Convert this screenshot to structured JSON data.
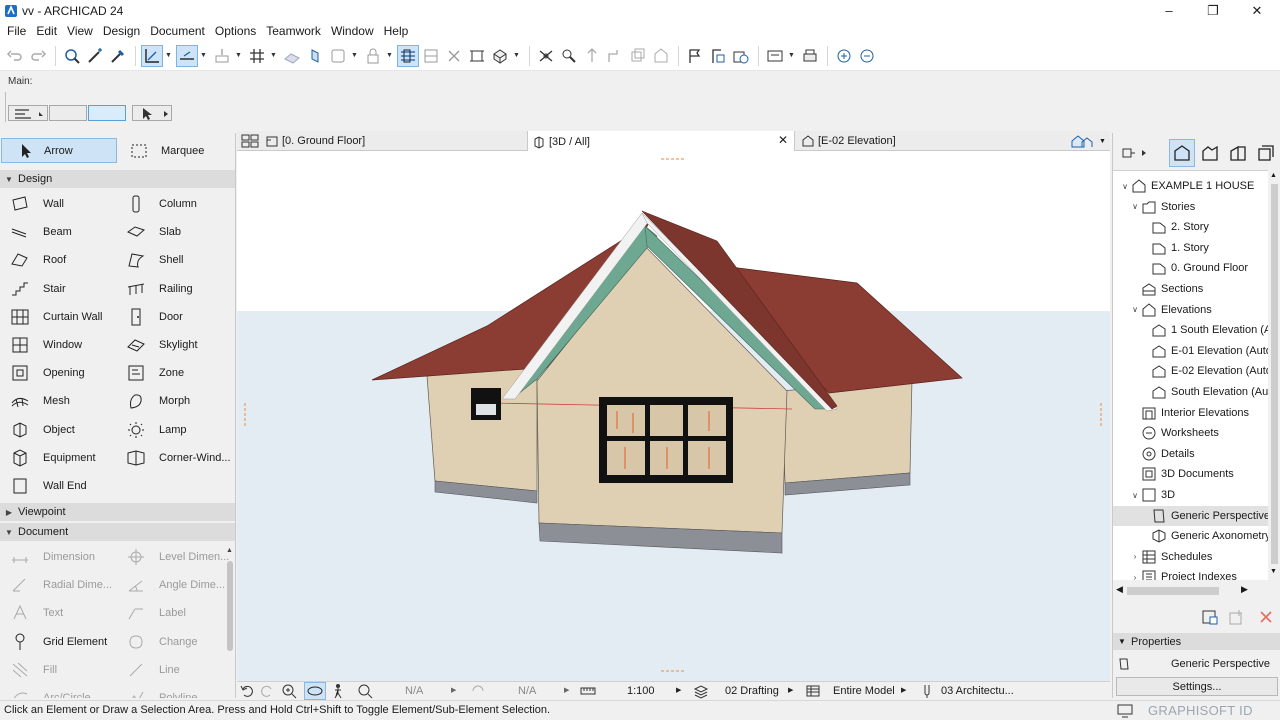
{
  "window": {
    "title": "vv - ARCHICAD 24",
    "minimize": "–",
    "maximize": "❐",
    "close": "✕"
  },
  "menu": [
    "File",
    "Edit",
    "View",
    "Design",
    "Document",
    "Options",
    "Teamwork",
    "Window",
    "Help"
  ],
  "infobox": {
    "main_label": "Main:"
  },
  "toolbox": {
    "arrow_label": "Arrow",
    "marquee_label": "Marquee",
    "design_header": "Design",
    "design_tools": [
      {
        "label": "Wall",
        "icon": "wall-icon"
      },
      {
        "label": "Column",
        "icon": "column-icon"
      },
      {
        "label": "Beam",
        "icon": "beam-icon"
      },
      {
        "label": "Slab",
        "icon": "slab-icon"
      },
      {
        "label": "Roof",
        "icon": "roof-icon"
      },
      {
        "label": "Shell",
        "icon": "shell-icon"
      },
      {
        "label": "Stair",
        "icon": "stair-icon"
      },
      {
        "label": "Railing",
        "icon": "railing-icon"
      },
      {
        "label": "Curtain Wall",
        "icon": "curtain-wall-icon"
      },
      {
        "label": "Door",
        "icon": "door-icon"
      },
      {
        "label": "Window",
        "icon": "window-icon"
      },
      {
        "label": "Skylight",
        "icon": "skylight-icon"
      },
      {
        "label": "Opening",
        "icon": "opening-icon"
      },
      {
        "label": "Zone",
        "icon": "zone-icon"
      },
      {
        "label": "Mesh",
        "icon": "mesh-icon"
      },
      {
        "label": "Morph",
        "icon": "morph-icon"
      },
      {
        "label": "Object",
        "icon": "object-icon"
      },
      {
        "label": "Lamp",
        "icon": "lamp-icon"
      },
      {
        "label": "Equipment",
        "icon": "equipment-icon"
      },
      {
        "label": "Corner-Wind...",
        "icon": "corner-window-icon"
      },
      {
        "label": "Wall End",
        "icon": "wall-end-icon"
      }
    ],
    "viewpoint_header": "Viewpoint",
    "document_header": "Document",
    "document_tools": [
      {
        "label": "Dimension",
        "icon": "dimension-icon"
      },
      {
        "label": "Level Dimen...",
        "icon": "level-dimension-icon"
      },
      {
        "label": "Radial Dime...",
        "icon": "radial-dimension-icon"
      },
      {
        "label": "Angle Dime...",
        "icon": "angle-dimension-icon"
      },
      {
        "label": "Text",
        "icon": "text-icon"
      },
      {
        "label": "Label",
        "icon": "label-icon"
      },
      {
        "label": "Grid Element",
        "icon": "grid-element-icon"
      },
      {
        "label": "Change",
        "icon": "change-icon"
      },
      {
        "label": "Fill",
        "icon": "fill-icon"
      },
      {
        "label": "Line",
        "icon": "line-icon"
      },
      {
        "label": "Arc/Circle",
        "icon": "arc-icon"
      },
      {
        "label": "Polyline",
        "icon": "polyline-icon"
      }
    ]
  },
  "tabs": [
    {
      "label": "[0. Ground Floor]",
      "icon": "floor-plan-icon"
    },
    {
      "label": "[3D / All]",
      "icon": "3d-view-icon",
      "active": true
    },
    {
      "label": "[E-02 Elevation]",
      "icon": "elevation-icon"
    }
  ],
  "viewbar": {
    "zoom1": "N/A",
    "zoom2": "N/A",
    "scale": "1:100",
    "layer_combo": "02 Drafting",
    "model_view": "Entire Model",
    "pen_set": "03 Architectu..."
  },
  "status": {
    "message": "Click an Element or Draw a Selection Area. Press and Hold Ctrl+Shift to Toggle Element/Sub-Element Selection.",
    "graphisoft": "GRAPHISOFT ID"
  },
  "navigator": {
    "tree": [
      {
        "label": "EXAMPLE 1 HOUSE",
        "level": 0,
        "toggle": "open",
        "icon": "project-icon"
      },
      {
        "label": "Stories",
        "level": 1,
        "toggle": "open",
        "icon": "stories-icon"
      },
      {
        "label": "2. Story",
        "level": 2,
        "toggle": "",
        "icon": "story-icon"
      },
      {
        "label": "1. Story",
        "level": 2,
        "toggle": "",
        "icon": "story-icon"
      },
      {
        "label": "0. Ground Floor",
        "level": 2,
        "toggle": "",
        "icon": "story-icon"
      },
      {
        "label": "Sections",
        "level": 1,
        "toggle": "",
        "icon": "sections-icon"
      },
      {
        "label": "Elevations",
        "level": 1,
        "toggle": "open",
        "icon": "elevations-icon"
      },
      {
        "label": "1 South Elevation (A",
        "level": 2,
        "toggle": "",
        "icon": "elevation-icon"
      },
      {
        "label": "E-01 Elevation (Auto",
        "level": 2,
        "toggle": "",
        "icon": "elevation-icon"
      },
      {
        "label": "E-02 Elevation (Auto",
        "level": 2,
        "toggle": "",
        "icon": "elevation-icon"
      },
      {
        "label": "South Elevation (Au",
        "level": 2,
        "toggle": "",
        "icon": "elevation-icon"
      },
      {
        "label": "Interior Elevations",
        "level": 1,
        "toggle": "",
        "icon": "interior-elevations-icon"
      },
      {
        "label": "Worksheets",
        "level": 1,
        "toggle": "",
        "icon": "worksheets-icon"
      },
      {
        "label": "Details",
        "level": 1,
        "toggle": "",
        "icon": "details-icon"
      },
      {
        "label": "3D Documents",
        "level": 1,
        "toggle": "",
        "icon": "3d-documents-icon"
      },
      {
        "label": "3D",
        "level": 1,
        "toggle": "open",
        "icon": "3d-icon"
      },
      {
        "label": "Generic Perspective",
        "level": 2,
        "toggle": "",
        "icon": "perspective-icon",
        "selected": true
      },
      {
        "label": "Generic Axonometry",
        "level": 2,
        "toggle": "",
        "icon": "axonometry-icon"
      },
      {
        "label": "Schedules",
        "level": 1,
        "toggle": "closed",
        "icon": "schedules-icon"
      },
      {
        "label": "Project Indexes",
        "level": 1,
        "toggle": "closed",
        "icon": "project-indexes-icon"
      }
    ],
    "properties_header": "Properties",
    "properties_value": "Generic Perspective",
    "settings_label": "Settings..."
  }
}
